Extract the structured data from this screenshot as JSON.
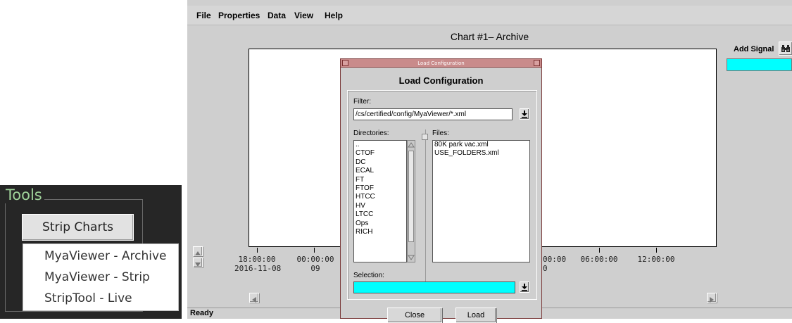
{
  "tools": {
    "title": "Tools",
    "strip_charts_label": "Strip Charts",
    "menu_items": [
      "MyaViewer - Archive",
      "MyaViewer - Strip",
      "StripTool - Live"
    ]
  },
  "app": {
    "menu": [
      "File",
      "Properties",
      "Data",
      "View",
      "Help"
    ],
    "chart_title": "Chart #1– Archive",
    "add_signal_label": "Add Signal",
    "status": "Ready",
    "time_axis": {
      "ticks": [
        {
          "time": "18:00:00",
          "date": "2016-11-08"
        },
        {
          "time": "00:00:00",
          "date": "09"
        },
        {
          "time": "00:00",
          "date": "0"
        },
        {
          "time": "06:00:00",
          "date": ""
        },
        {
          "time": "12:00:00",
          "date": ""
        }
      ]
    }
  },
  "dialog": {
    "window_title": "Load Configuration",
    "heading": "Load Configuration",
    "filter_label": "Filter:",
    "filter_value": "/cs/certified/config/MyaViewer/*.xml",
    "directories_label": "Directories:",
    "directories": [
      "..",
      "CTOF",
      "DC",
      "ECAL",
      "FT",
      "FTOF",
      "HTCC",
      "HV",
      "LTCC",
      "Ops",
      "RICH"
    ],
    "files_label": "Files:",
    "files": [
      "80K park vac.xml",
      "USE_FOLDERS.xml"
    ],
    "selection_label": "Selection:",
    "selection_value": "",
    "close_label": "Close",
    "load_label": "Load"
  },
  "colors": {
    "tools_bg": "#262626",
    "tools_title": "#9fd39a",
    "cyan_field": "#00ffff",
    "dialog_titlebar": "#c98b8b"
  }
}
